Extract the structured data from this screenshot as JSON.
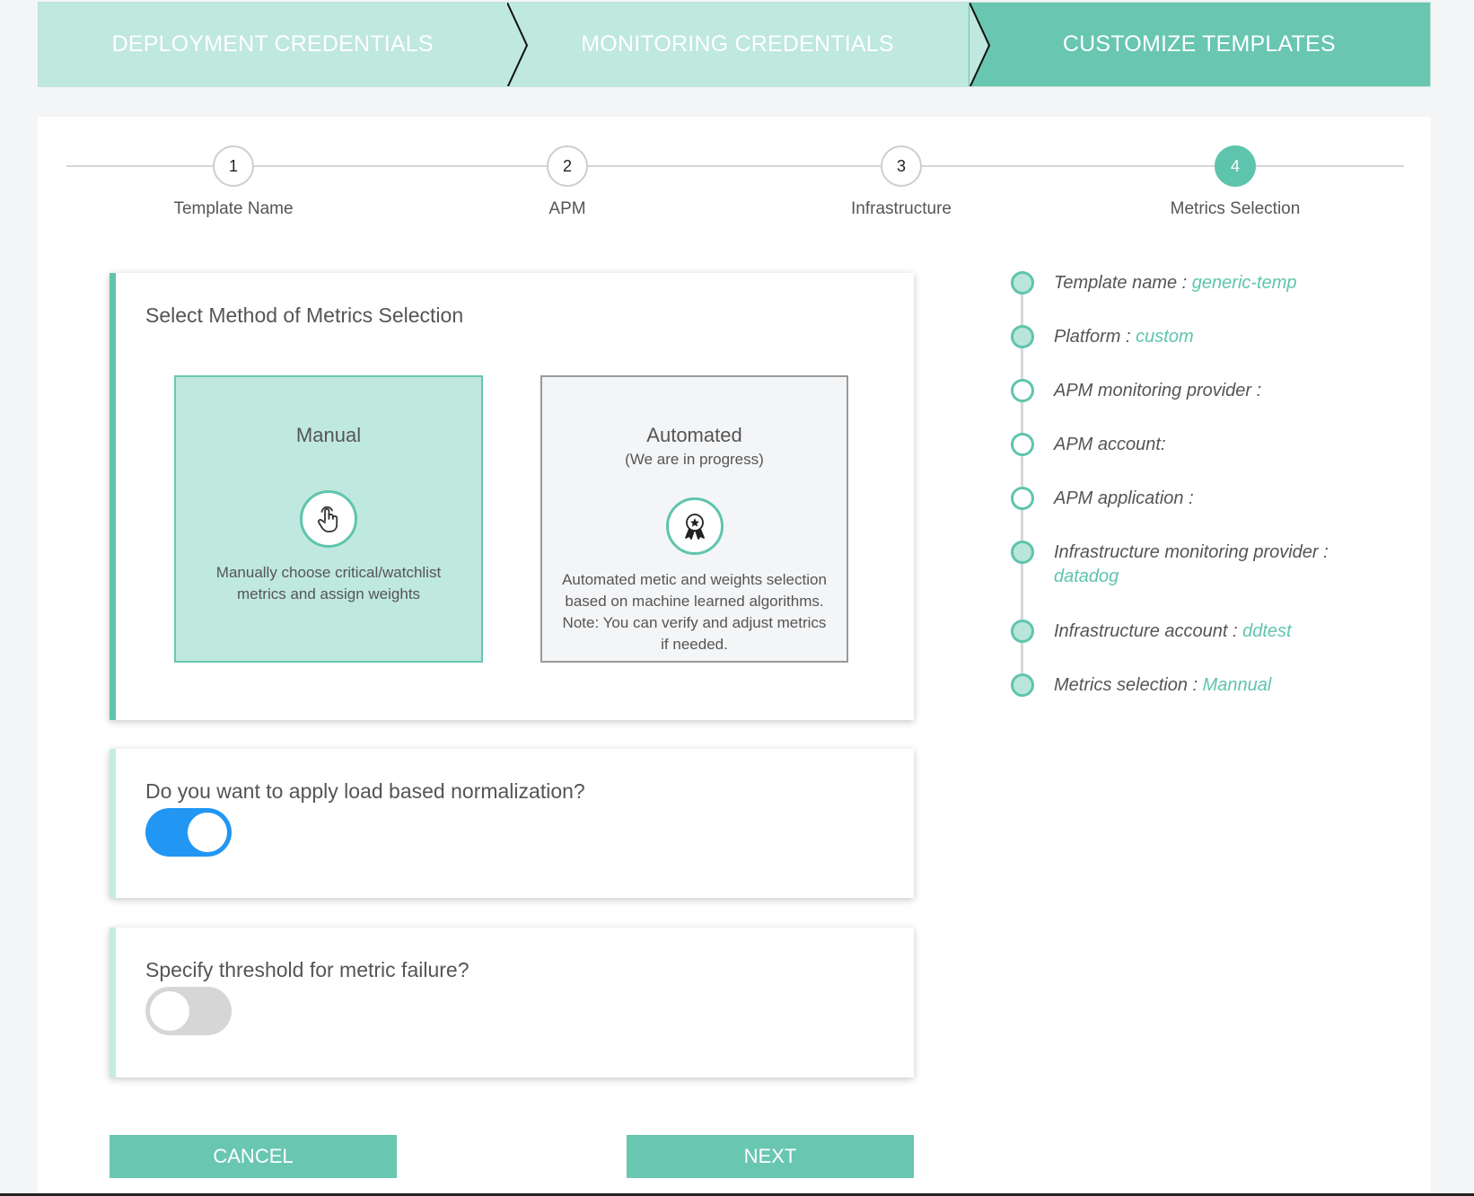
{
  "wizard": {
    "steps": [
      {
        "label": "DEPLOYMENT CREDENTIALS"
      },
      {
        "label": "MONITORING CREDENTIALS"
      },
      {
        "label": "CUSTOMIZE TEMPLATES"
      }
    ],
    "active_index": 2
  },
  "stepper": {
    "steps": [
      {
        "number": "1",
        "label": "Template Name"
      },
      {
        "number": "2",
        "label": "APM"
      },
      {
        "number": "3",
        "label": "Infrastructure"
      },
      {
        "number": "4",
        "label": "Metrics Selection"
      }
    ],
    "active_index": 3
  },
  "method": {
    "title": "Select Method of Metrics Selection",
    "manual": {
      "title": "Manual",
      "icon": "pointer-hand-icon",
      "description": "Manually choose critical/watchlist metrics and assign weights",
      "selected": true
    },
    "automated": {
      "title": "Automated",
      "subtitle": "(We are in progress)",
      "icon": "award-ribbon-icon",
      "description": "Automated metic and weights selection based on machine learned algorithms. Note: You can verify and adjust metrics if needed.",
      "selected": false
    }
  },
  "normalization": {
    "question": "Do you want to apply load based normalization?",
    "enabled": true
  },
  "threshold": {
    "question": "Specify threshold for metric failure?",
    "enabled": false
  },
  "buttons": {
    "cancel": "CANCEL",
    "next": "NEXT"
  },
  "summary": {
    "items": [
      {
        "label": "Template name :",
        "value": "generic-temp",
        "filled": true
      },
      {
        "label": "Platform :",
        "value": "custom",
        "filled": true
      },
      {
        "label": "APM monitoring provider :",
        "value": "",
        "filled": false
      },
      {
        "label": "APM account:",
        "value": "",
        "filled": false
      },
      {
        "label": "APM application :",
        "value": "",
        "filled": false
      },
      {
        "label": "Infrastructure monitoring provider :",
        "value": "datadog",
        "filled": true
      },
      {
        "label": "Infrastructure account :",
        "value": "ddtest",
        "filled": true
      },
      {
        "label": "Metrics selection :",
        "value": "Mannual",
        "filled": true
      }
    ]
  },
  "colors": {
    "accent": "#68c6b1",
    "accent_light": "#bfe8df",
    "toggle_on": "#2196f3",
    "toggle_off": "#d6d6d6"
  }
}
